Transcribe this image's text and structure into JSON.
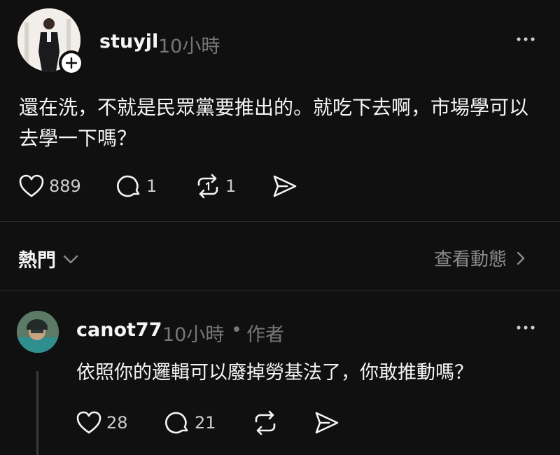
{
  "post": {
    "username": "stuyjl",
    "time": "10小時",
    "text": "還在洗，不就是民眾黨要推出的。就吃下去啊，市場學可以去學一下嗎？",
    "likes": "889",
    "comments": "1",
    "reposts": "1"
  },
  "sort": {
    "label": "熱門",
    "view_activity": "查看動態"
  },
  "reply": {
    "username": "canot77",
    "time": "10小時",
    "separator": "•",
    "author_tag": "作者",
    "text": "依照你的邏輯可以廢掉勞基法了，你敢推動嗎？",
    "likes": "28",
    "comments": "21"
  },
  "icons": {
    "like": "heart-icon",
    "comment": "speech-bubble-icon",
    "repost": "repost-icon",
    "share": "send-icon",
    "more": "more-horizontal-icon",
    "follow": "plus-icon",
    "chevron": "chevron-down-icon",
    "arrow": "chevron-right-icon"
  }
}
